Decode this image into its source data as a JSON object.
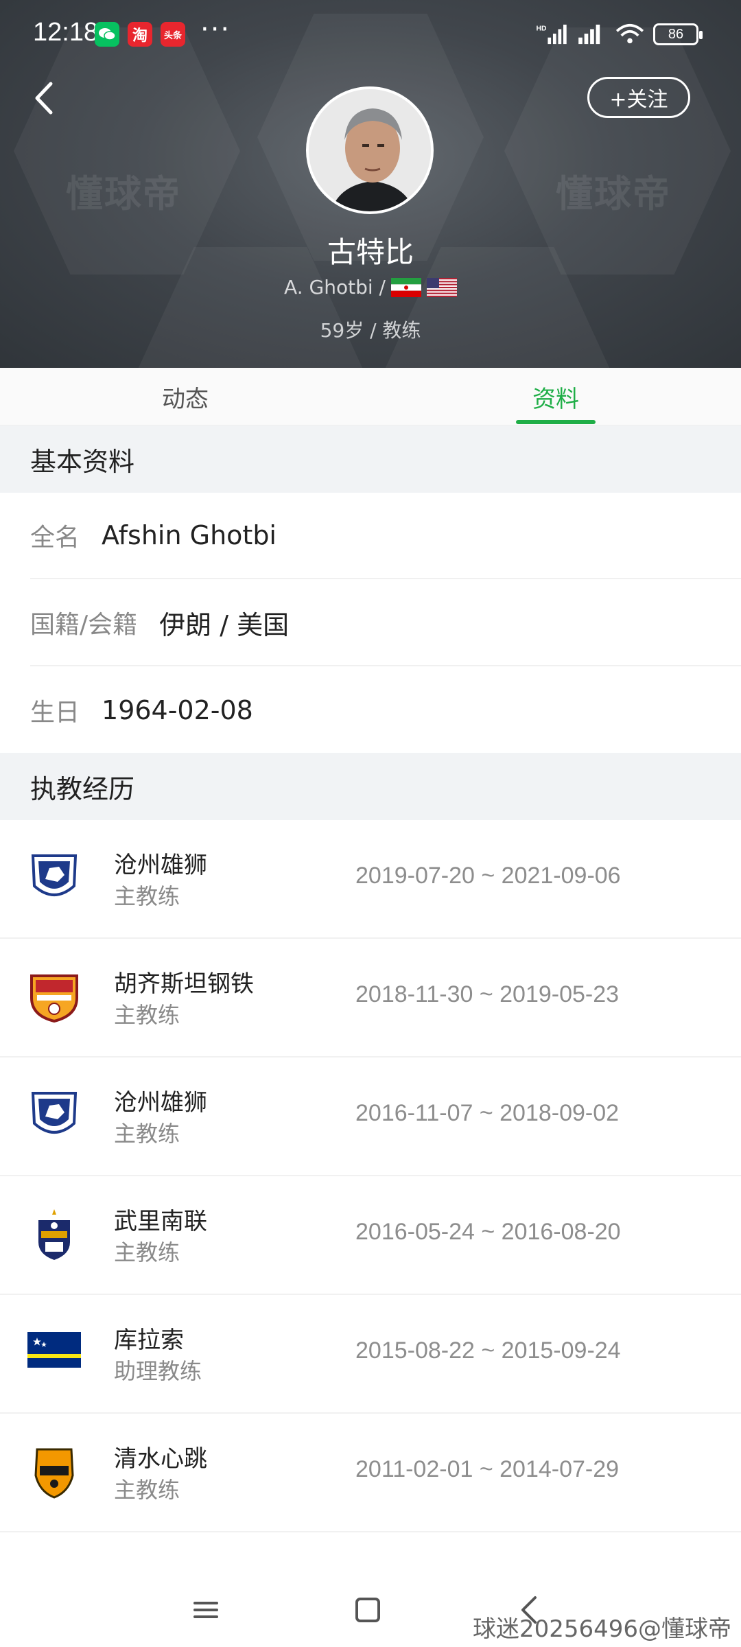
{
  "status_bar": {
    "time": "12:18",
    "app_icons": [
      "wechat-icon",
      "taobao-icon",
      "toutiao-icon"
    ],
    "taobao_glyph": "淘",
    "toutiao_glyph": "头条",
    "more": "···",
    "signal_label": "HD",
    "battery": "86"
  },
  "header": {
    "watermark": "懂球帝",
    "follow_label": "+关注",
    "name": "古特比",
    "latin_name": "A. Ghotbi /",
    "age_role": "59岁 / 教练",
    "flags": [
      "iran-flag-icon",
      "usa-flag-icon"
    ]
  },
  "tabs": [
    {
      "label": "动态",
      "active": false
    },
    {
      "label": "资料",
      "active": true
    }
  ],
  "basic_info": {
    "title": "基本资料",
    "rows": [
      {
        "label": "全名",
        "value": "Afshin Ghotbi"
      },
      {
        "label": "国籍/会籍",
        "value": "伊朗 / 美国"
      },
      {
        "label": "生日",
        "value": "1964-02-08"
      }
    ]
  },
  "career": {
    "title": "执教经历",
    "items": [
      {
        "club": "沧州雄狮",
        "role": "主教练",
        "dates": "2019-07-20 ~ 2021-09-06",
        "logo": "cangzhou-logo"
      },
      {
        "club": "胡齐斯坦钢铁",
        "role": "主教练",
        "dates": "2018-11-30 ~ 2019-05-23",
        "logo": "foolad-logo"
      },
      {
        "club": "沧州雄狮",
        "role": "主教练",
        "dates": "2016-11-07 ~ 2018-09-02",
        "logo": "cangzhou-logo"
      },
      {
        "club": "武里南联",
        "role": "主教练",
        "dates": "2016-05-24 ~ 2016-08-20",
        "logo": "buriram-logo"
      },
      {
        "club": "库拉索",
        "role": "助理教练",
        "dates": "2015-08-22 ~ 2015-09-24",
        "logo": "curacao-flag"
      },
      {
        "club": "清水心跳",
        "role": "主教练",
        "dates": "2011-02-01 ~ 2014-07-29",
        "logo": "s-pulse-logo"
      }
    ]
  },
  "footer": {
    "credit": "球迷20256496@懂球帝"
  },
  "colors": {
    "accent": "#1fae47",
    "header_bg": "#3b4046",
    "section_bg": "#f1f3f5"
  }
}
